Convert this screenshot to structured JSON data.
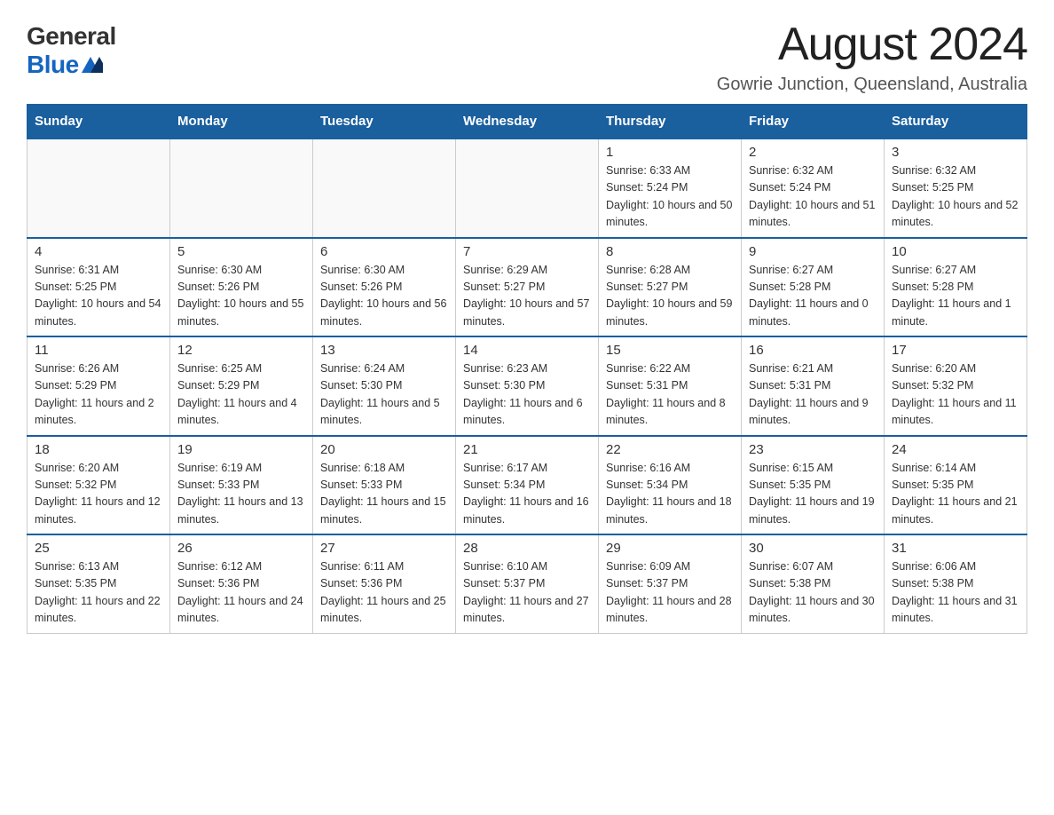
{
  "logo": {
    "general": "General",
    "blue": "Blue"
  },
  "header": {
    "month_year": "August 2024",
    "location": "Gowrie Junction, Queensland, Australia"
  },
  "weekdays": [
    "Sunday",
    "Monday",
    "Tuesday",
    "Wednesday",
    "Thursday",
    "Friday",
    "Saturday"
  ],
  "weeks": [
    [
      {
        "day": "",
        "detail": ""
      },
      {
        "day": "",
        "detail": ""
      },
      {
        "day": "",
        "detail": ""
      },
      {
        "day": "",
        "detail": ""
      },
      {
        "day": "1",
        "detail": "Sunrise: 6:33 AM\nSunset: 5:24 PM\nDaylight: 10 hours and 50 minutes."
      },
      {
        "day": "2",
        "detail": "Sunrise: 6:32 AM\nSunset: 5:24 PM\nDaylight: 10 hours and 51 minutes."
      },
      {
        "day": "3",
        "detail": "Sunrise: 6:32 AM\nSunset: 5:25 PM\nDaylight: 10 hours and 52 minutes."
      }
    ],
    [
      {
        "day": "4",
        "detail": "Sunrise: 6:31 AM\nSunset: 5:25 PM\nDaylight: 10 hours and 54 minutes."
      },
      {
        "day": "5",
        "detail": "Sunrise: 6:30 AM\nSunset: 5:26 PM\nDaylight: 10 hours and 55 minutes."
      },
      {
        "day": "6",
        "detail": "Sunrise: 6:30 AM\nSunset: 5:26 PM\nDaylight: 10 hours and 56 minutes."
      },
      {
        "day": "7",
        "detail": "Sunrise: 6:29 AM\nSunset: 5:27 PM\nDaylight: 10 hours and 57 minutes."
      },
      {
        "day": "8",
        "detail": "Sunrise: 6:28 AM\nSunset: 5:27 PM\nDaylight: 10 hours and 59 minutes."
      },
      {
        "day": "9",
        "detail": "Sunrise: 6:27 AM\nSunset: 5:28 PM\nDaylight: 11 hours and 0 minutes."
      },
      {
        "day": "10",
        "detail": "Sunrise: 6:27 AM\nSunset: 5:28 PM\nDaylight: 11 hours and 1 minute."
      }
    ],
    [
      {
        "day": "11",
        "detail": "Sunrise: 6:26 AM\nSunset: 5:29 PM\nDaylight: 11 hours and 2 minutes."
      },
      {
        "day": "12",
        "detail": "Sunrise: 6:25 AM\nSunset: 5:29 PM\nDaylight: 11 hours and 4 minutes."
      },
      {
        "day": "13",
        "detail": "Sunrise: 6:24 AM\nSunset: 5:30 PM\nDaylight: 11 hours and 5 minutes."
      },
      {
        "day": "14",
        "detail": "Sunrise: 6:23 AM\nSunset: 5:30 PM\nDaylight: 11 hours and 6 minutes."
      },
      {
        "day": "15",
        "detail": "Sunrise: 6:22 AM\nSunset: 5:31 PM\nDaylight: 11 hours and 8 minutes."
      },
      {
        "day": "16",
        "detail": "Sunrise: 6:21 AM\nSunset: 5:31 PM\nDaylight: 11 hours and 9 minutes."
      },
      {
        "day": "17",
        "detail": "Sunrise: 6:20 AM\nSunset: 5:32 PM\nDaylight: 11 hours and 11 minutes."
      }
    ],
    [
      {
        "day": "18",
        "detail": "Sunrise: 6:20 AM\nSunset: 5:32 PM\nDaylight: 11 hours and 12 minutes."
      },
      {
        "day": "19",
        "detail": "Sunrise: 6:19 AM\nSunset: 5:33 PM\nDaylight: 11 hours and 13 minutes."
      },
      {
        "day": "20",
        "detail": "Sunrise: 6:18 AM\nSunset: 5:33 PM\nDaylight: 11 hours and 15 minutes."
      },
      {
        "day": "21",
        "detail": "Sunrise: 6:17 AM\nSunset: 5:34 PM\nDaylight: 11 hours and 16 minutes."
      },
      {
        "day": "22",
        "detail": "Sunrise: 6:16 AM\nSunset: 5:34 PM\nDaylight: 11 hours and 18 minutes."
      },
      {
        "day": "23",
        "detail": "Sunrise: 6:15 AM\nSunset: 5:35 PM\nDaylight: 11 hours and 19 minutes."
      },
      {
        "day": "24",
        "detail": "Sunrise: 6:14 AM\nSunset: 5:35 PM\nDaylight: 11 hours and 21 minutes."
      }
    ],
    [
      {
        "day": "25",
        "detail": "Sunrise: 6:13 AM\nSunset: 5:35 PM\nDaylight: 11 hours and 22 minutes."
      },
      {
        "day": "26",
        "detail": "Sunrise: 6:12 AM\nSunset: 5:36 PM\nDaylight: 11 hours and 24 minutes."
      },
      {
        "day": "27",
        "detail": "Sunrise: 6:11 AM\nSunset: 5:36 PM\nDaylight: 11 hours and 25 minutes."
      },
      {
        "day": "28",
        "detail": "Sunrise: 6:10 AM\nSunset: 5:37 PM\nDaylight: 11 hours and 27 minutes."
      },
      {
        "day": "29",
        "detail": "Sunrise: 6:09 AM\nSunset: 5:37 PM\nDaylight: 11 hours and 28 minutes."
      },
      {
        "day": "30",
        "detail": "Sunrise: 6:07 AM\nSunset: 5:38 PM\nDaylight: 11 hours and 30 minutes."
      },
      {
        "day": "31",
        "detail": "Sunrise: 6:06 AM\nSunset: 5:38 PM\nDaylight: 11 hours and 31 minutes."
      }
    ]
  ]
}
